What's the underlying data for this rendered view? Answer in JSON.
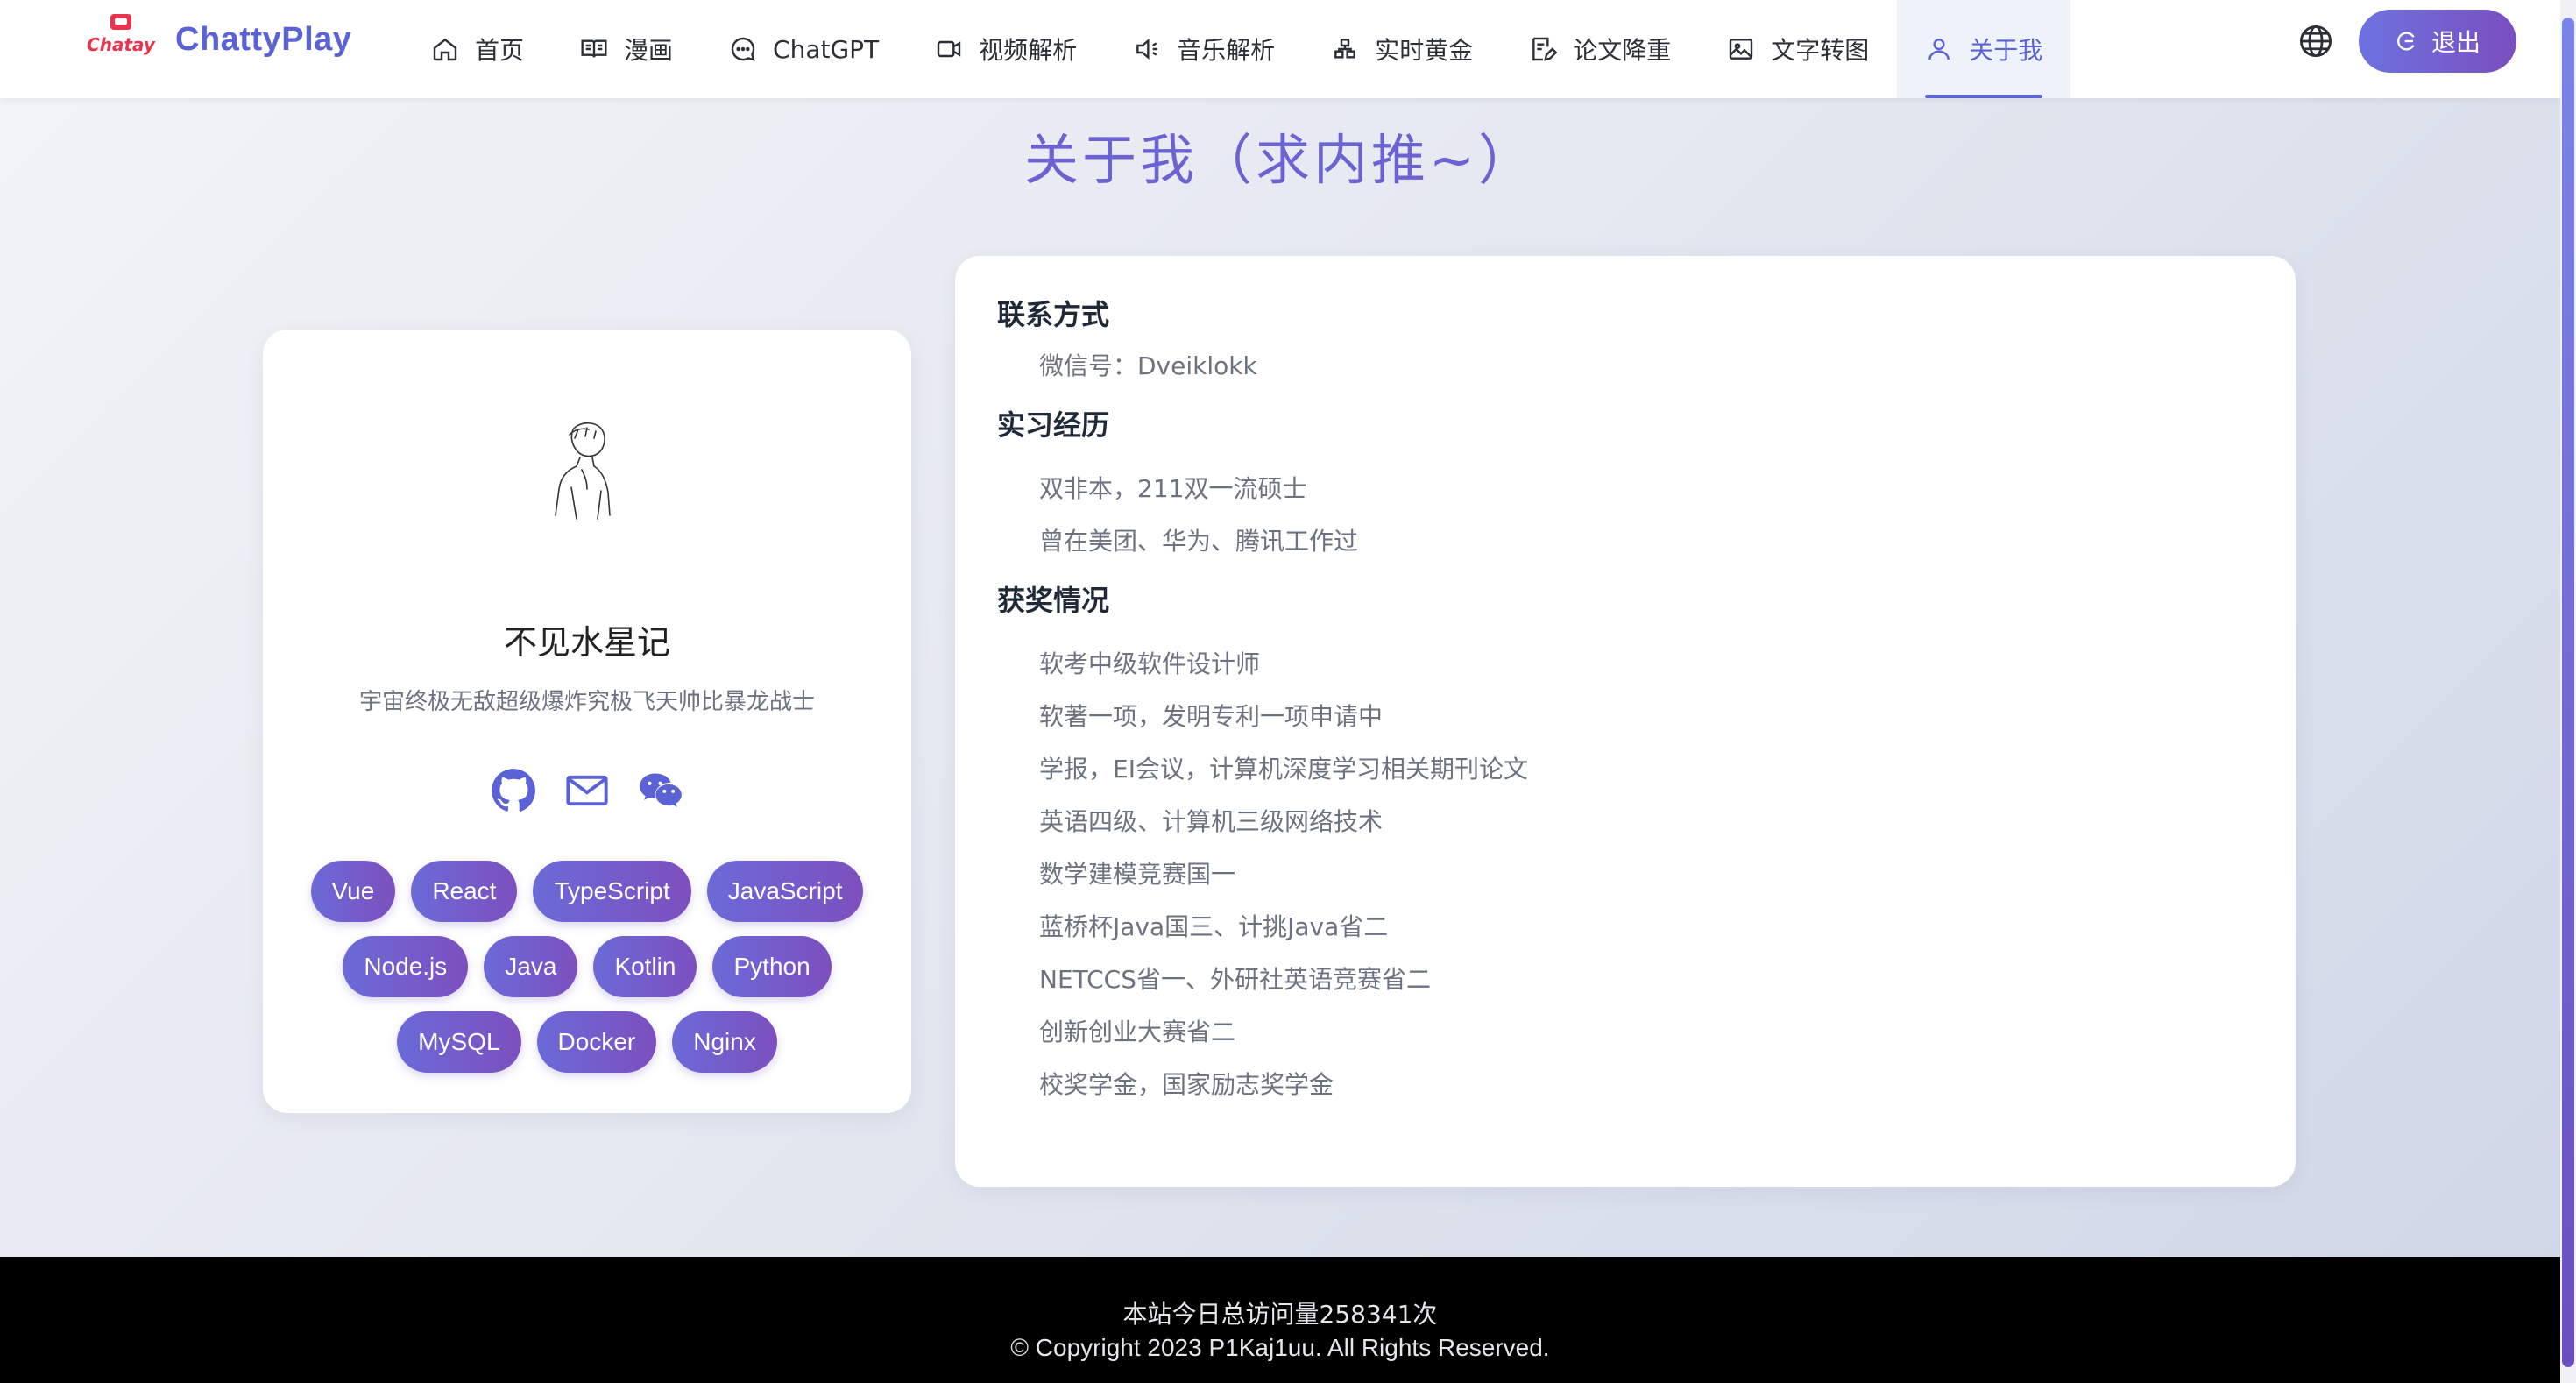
{
  "header": {
    "logo_text": "Chatay",
    "brand": "ChattyPlay",
    "nav": [
      {
        "label": "首页",
        "icon": "home-icon"
      },
      {
        "label": "漫画",
        "icon": "book-icon"
      },
      {
        "label": "ChatGPT",
        "icon": "chat-icon"
      },
      {
        "label": "视频解析",
        "icon": "video-icon"
      },
      {
        "label": "音乐解析",
        "icon": "speaker-icon"
      },
      {
        "label": "实时黄金",
        "icon": "gold-icon"
      },
      {
        "label": "论文降重",
        "icon": "document-edit-icon"
      },
      {
        "label": "文字转图",
        "icon": "image-icon"
      },
      {
        "label": "关于我",
        "icon": "user-icon",
        "active": true
      }
    ],
    "logout_label": "退出"
  },
  "page": {
    "title": "关于我（求内推~）"
  },
  "profile": {
    "name": "不见水星记",
    "motto": "宇宙终极无敌超级爆炸究极飞天帅比暴龙战士",
    "social": [
      "github-icon",
      "mail-icon",
      "wechat-icon"
    ],
    "tags": [
      "Vue",
      "React",
      "TypeScript",
      "JavaScript",
      "Node.js",
      "Java",
      "Kotlin",
      "Python",
      "MySQL",
      "Docker",
      "Nginx"
    ]
  },
  "info": {
    "sections": [
      {
        "title": "联系方式",
        "items": [
          "微信号：Dveiklokk"
        ]
      },
      {
        "title": "实习经历",
        "items": [
          "双非本，211双一流硕士",
          "曾在美团、华为、腾讯工作过"
        ]
      },
      {
        "title": "获奖情况",
        "items": [
          "软考中级软件设计师",
          "软著一项，发明专利一项申请中",
          "学报，EI会议，计算机深度学习相关期刊论文",
          "英语四级、计算机三级网络技术",
          "数学建模竞赛国一",
          "蓝桥杯Java国三、计挑Java省二",
          "NETCCS省一、外研社英语竞赛省二",
          "创新创业大赛省二",
          "校奖学金，国家励志奖学金"
        ]
      }
    ]
  },
  "footer": {
    "visits": "本站今日总访问量258341次",
    "copyright": "© Copyright 2023 P1Kaj1uu. All Rights Reserved."
  },
  "colors": {
    "accent": "#5b62d6",
    "gradient_start": "#6b6ad8",
    "gradient_end": "#7d4fbe",
    "footer_bg": "#000000"
  }
}
